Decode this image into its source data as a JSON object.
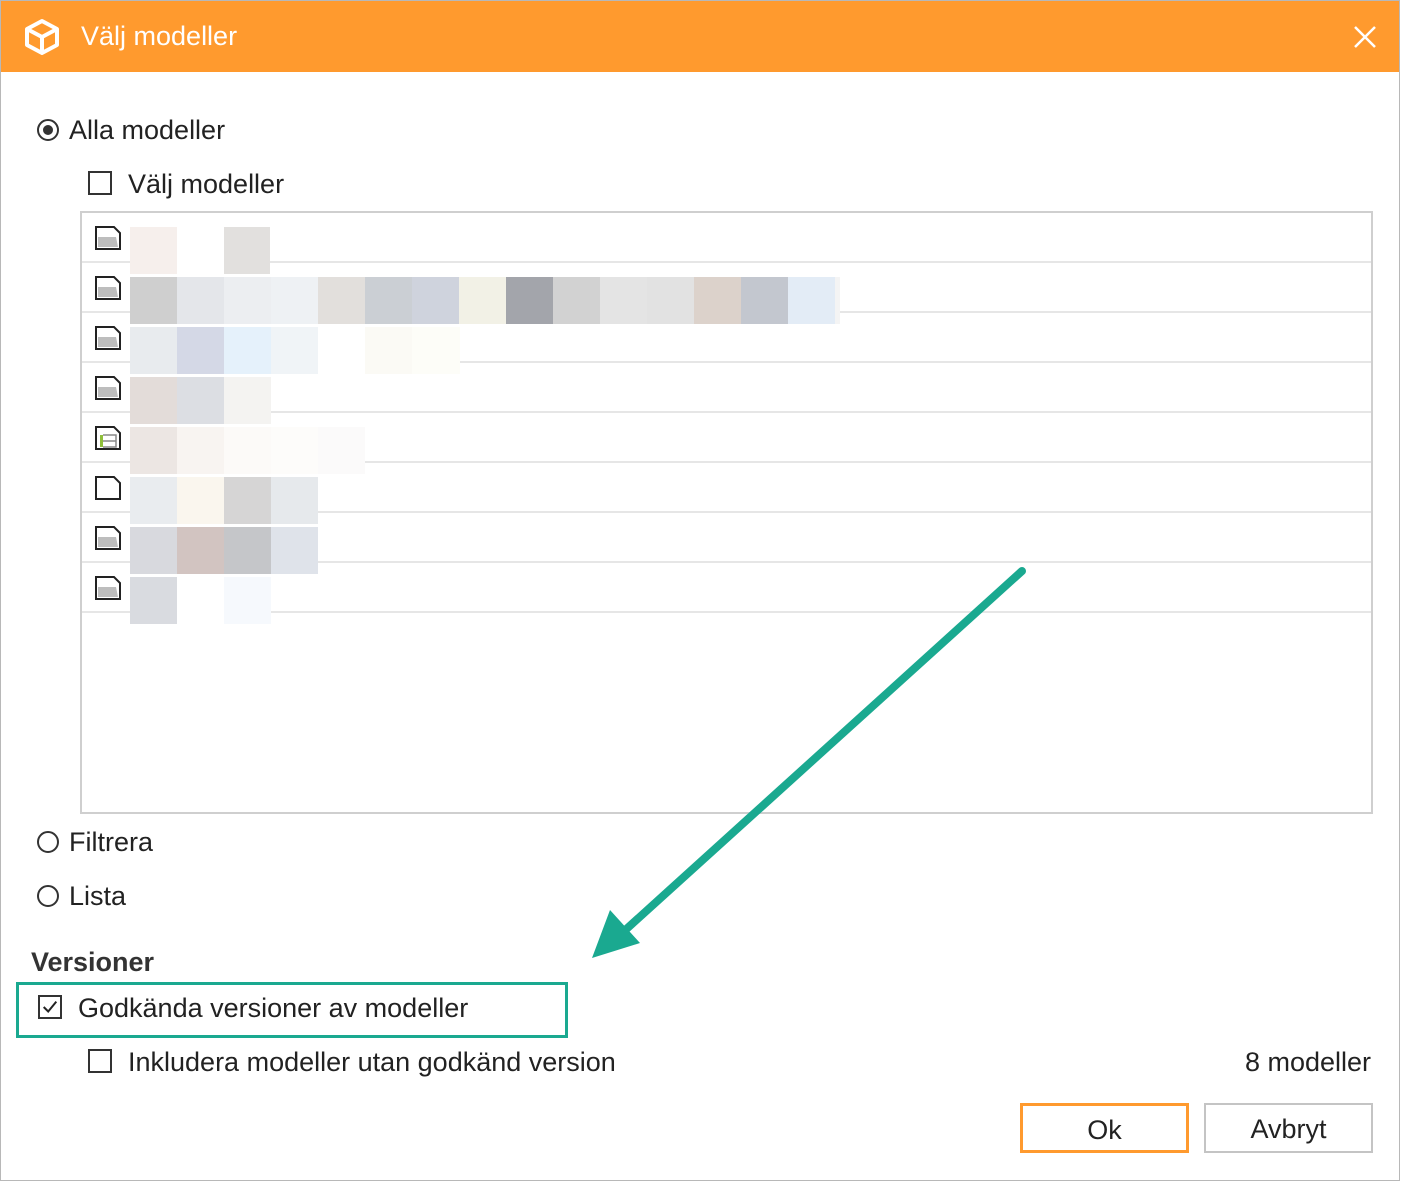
{
  "window": {
    "title": "Välj modeller",
    "accent_color": "#ff9a2e",
    "app_icon": "cube-logo-icon",
    "close_icon": "close-icon"
  },
  "scope": {
    "all_models_label": "Alla modeller",
    "all_models_selected": true,
    "select_models_label": "Välj modeller",
    "select_models_checked": false,
    "model_rows": [
      {
        "icon": "model-file-icon",
        "name": ""
      },
      {
        "icon": "model-file-icon",
        "name": ""
      },
      {
        "icon": "model-file-icon",
        "name": ""
      },
      {
        "icon": "model-file-icon",
        "name": ""
      },
      {
        "icon": "model-plan-file-icon",
        "name": ""
      },
      {
        "icon": "blank-file-icon",
        "name": ""
      },
      {
        "icon": "model-file-icon",
        "name": ""
      },
      {
        "icon": "model-file-icon",
        "name": ""
      }
    ],
    "filter_label": "Filtrera",
    "list_label": "Lista"
  },
  "versions": {
    "section_title": "Versioner",
    "approved_label": "Godkända versioner av modeller",
    "approved_checked": true,
    "include_label": "Inkludera modeller utan godkänd version",
    "include_checked": false,
    "count_text": "8 modeller",
    "highlight_color": "#1aa990"
  },
  "buttons": {
    "ok_label": "Ok",
    "cancel_label": "Avbryt"
  }
}
